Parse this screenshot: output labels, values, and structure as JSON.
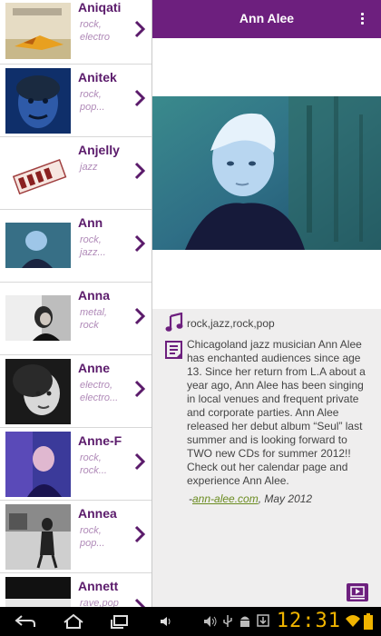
{
  "artists": [
    {
      "name": "Aniqati",
      "genre": "rock, electro"
    },
    {
      "name": "Anitek",
      "genre": "rock, pop..."
    },
    {
      "name": "Anjelly",
      "genre": "jazz"
    },
    {
      "name": "Ann",
      "genre": "rock, jazz..."
    },
    {
      "name": "Anna",
      "genre": "metal, rock"
    },
    {
      "name": "Anne",
      "genre": "electro, electro..."
    },
    {
      "name": "Anne-F",
      "genre": "rock, rock..."
    },
    {
      "name": "Annea",
      "genre": "rock, pop..."
    },
    {
      "name": "Annett",
      "genre": "rave,pop"
    }
  ],
  "header": {
    "title": "Ann Alee"
  },
  "detail": {
    "tags": "rock,jazz,rock,pop",
    "bio": "Chicagoland jazz musician Ann Alee has enchanted audiences since age 13. Since her return from L.A about a year ago, Ann Alee has been singing in local venues and frequent private and corporate parties. Ann Alee released her debut album “Seul” last summer and is looking forward to TWO new CDs for summer 2012!! Check out her calendar page and experience Ann Alee.",
    "credit_prefix": "-",
    "credit_link": "ann-alee.com",
    "credit_suffix": ", May 2012"
  },
  "status": {
    "clock": "12:31"
  },
  "colors": {
    "accent": "#6d1f7e",
    "name": "#5b1b6b",
    "genre": "#b08ab8",
    "link": "#6b8c21",
    "clock": "#f0b400"
  }
}
